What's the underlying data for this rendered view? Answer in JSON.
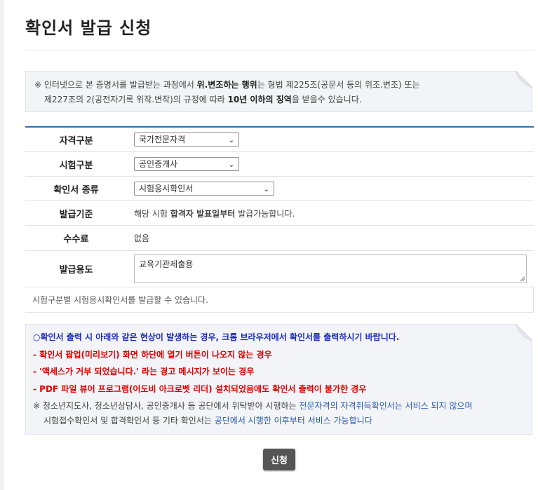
{
  "page": {
    "title": "확인서 발급 신청"
  },
  "notice_top": {
    "p1": "※ 인터넷으로 본 증명서를 발급받는 과정에서 ",
    "b1": "위.변조하는 행위",
    "p2": "는 형법 제225조(공문서 등의 위조.변조) 또는",
    "p3": "제227조의 2(공전자기록 위작.변작)의 규정에 따라 ",
    "b2": "10년 이하의 징역",
    "p4": "을 받을수 있습니다."
  },
  "form": {
    "qual_type": {
      "label": "자격구분",
      "selected": "국가전문자격"
    },
    "exam_type": {
      "label": "시험구분",
      "selected": "공인중개사"
    },
    "cert_type": {
      "label": "확인서 종류",
      "selected": "시험응시확인서"
    },
    "criteria": {
      "label": "발급기준",
      "t1": "해당 시험 ",
      "b": "합격자 발표일부터",
      "t2": " 발급가능합니다."
    },
    "fee": {
      "label": "수수료",
      "value": "없음"
    },
    "purpose": {
      "label": "발급용도",
      "value": "교육기관제출용"
    },
    "note": "시험구분별 시험응시확인서를 발급할 수 있습니다."
  },
  "notice_bottom": {
    "head": "○확인서 출력 시 아래와 같은 현상이 발생하는 경우, 크롬 브라우저에서 확인서를 출력하시기 바랍니다.",
    "items": [
      "- 확인서 팝업(미리보기) 화면 하단에 열기 버튼이 나오지 않는 경우",
      "- '액세스가 거부 되었습니다.' 라는 경고 메시지가 보이는 경우",
      "- PDF 파일 뷰어 프로그램(어도비 아크로벳 리더) 설치되었음에도 확인서 출력이 불가한 경우"
    ],
    "foot1a": "※ 청소년지도사, 청소년상담사, 공인중개사 등 공단에서 위탁받아 시행하는 ",
    "foot1b": "전문자격의 자격취득확인서는 서비스 되지 않으며",
    "foot2a": "시험접수확인서 및 합격확인서 등 기타 확인서는 ",
    "foot2b": "공단에서 시행한 이후부터 서비스 가능합니다"
  },
  "buttons": {
    "apply": "신청"
  },
  "icons": {
    "dropdown": "chevron-down-icon",
    "fold": "folded-corner-icon"
  },
  "colors": {
    "table_top_border": "#3a6ea8",
    "notice_bg": "#f3f4f8",
    "head_blue": "#1a2bb8",
    "warn_red": "#e00000",
    "button": "#555555"
  }
}
